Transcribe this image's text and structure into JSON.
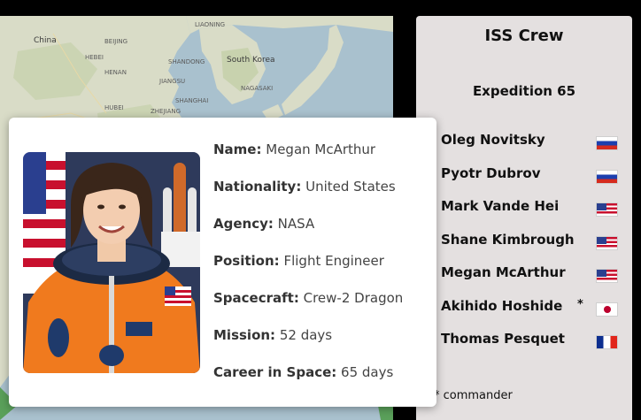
{
  "map": {
    "labels": {
      "china": "China",
      "south_korea": "South Korea",
      "beijing": "BEIJING",
      "shandong": "SHANDONG",
      "henan": "HENAN",
      "jiangsu": "JIANGSU",
      "hubei": "HUBEI",
      "shanghai": "SHANGHAI",
      "zhejiang": "ZHEJIANG",
      "hebei": "HEBEI",
      "liaoning": "LIAONING",
      "nagasaki": "NAGASAKI"
    }
  },
  "crew_panel": {
    "title": "ISS Crew",
    "expedition": "Expedition 65",
    "members": [
      {
        "name": "Oleg Novitsky",
        "flag": "ru",
        "commander": false
      },
      {
        "name": "Pyotr Dubrov",
        "flag": "ru",
        "commander": false
      },
      {
        "name": "Mark Vande Hei",
        "flag": "us",
        "commander": false
      },
      {
        "name": "Shane Kimbrough",
        "flag": "us",
        "commander": false
      },
      {
        "name": "Megan McArthur",
        "flag": "us",
        "commander": false
      },
      {
        "name": "Akihido Hoshide",
        "flag": "jp",
        "commander": true
      },
      {
        "name": "Thomas Pesquet",
        "flag": "fr",
        "commander": false
      }
    ],
    "commander_star": "*",
    "commander_note": "* commander"
  },
  "detail_card": {
    "photo_icon": "astronaut-portrait",
    "fields": [
      {
        "key": "Name:",
        "value": "Megan McArthur"
      },
      {
        "key": "Nationality:",
        "value": "United States"
      },
      {
        "key": "Agency:",
        "value": "NASA"
      },
      {
        "key": "Position:",
        "value": "Flight Engineer"
      },
      {
        "key": "Spacecraft:",
        "value": "Crew-2 Dragon"
      },
      {
        "key": "Mission:",
        "value": "52 days"
      },
      {
        "key": "Career in Space:",
        "value": "65 days"
      }
    ]
  },
  "colors": {
    "panel_bg": "#e4e0e0",
    "map_water": "#a9c1ce",
    "map_land": "#d9dcc7",
    "suit_orange": "#f07a1e"
  }
}
